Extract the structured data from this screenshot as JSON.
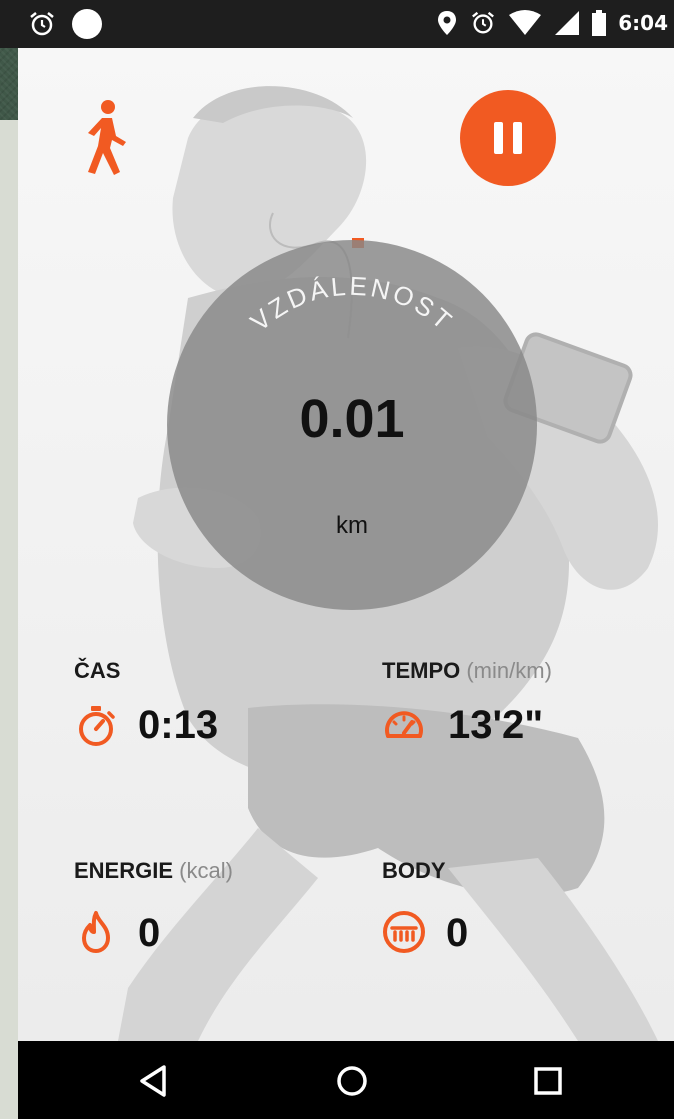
{
  "status_bar": {
    "time": "6:04",
    "left_icons": [
      "alarm-icon",
      "notification-dot-icon"
    ],
    "right_icons": [
      "location-pin-icon",
      "alarm-icon",
      "wifi-icon",
      "signal-icon",
      "battery-icon"
    ]
  },
  "header": {
    "activity_icon": "walking-person-icon",
    "pause_button_icon": "pause-icon"
  },
  "gauge": {
    "label": "VZDÁLENOST",
    "value": "0.01",
    "unit": "km"
  },
  "stats": {
    "time": {
      "label": "ČAS",
      "value": "0:13",
      "icon": "stopwatch-icon"
    },
    "pace": {
      "label": "TEMPO",
      "unit": "(min/km)",
      "value": "13'2\"",
      "icon": "speedometer-icon"
    },
    "energy": {
      "label": "ENERGIE",
      "unit": "(kcal)",
      "value": "0",
      "icon": "flame-icon"
    },
    "points": {
      "label": "BODY",
      "value": "0",
      "icon": "points-badge-icon"
    }
  },
  "nav_bar": {
    "buttons": [
      "back-icon",
      "home-icon",
      "recents-icon"
    ]
  },
  "colors": {
    "accent": "#f15a22",
    "status_bar": "#1e1e1e",
    "nav_bar": "#000000"
  }
}
